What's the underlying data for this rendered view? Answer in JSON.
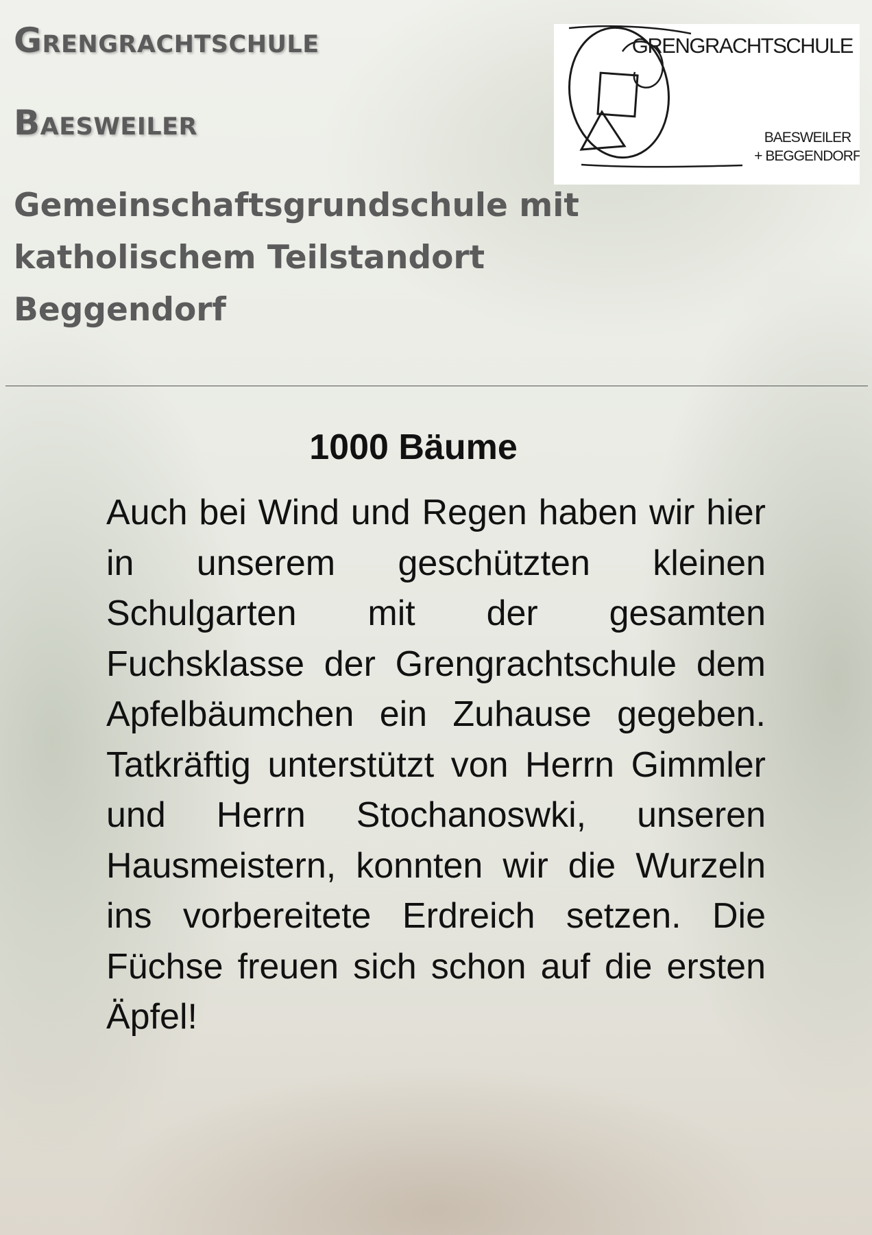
{
  "header": {
    "school_name_line1": "Grengrachtschule",
    "school_name_line2": "Baesweiler",
    "subtitle_line1": "Gemeinschaftsgrundschule mit",
    "subtitle_line2": "katholischem Teilstandort",
    "subtitle_line3": "Beggendorf"
  },
  "logo": {
    "title": "GRENGRACHTSCHULE",
    "location_line1": "BAESWEILER",
    "location_line2": "+ BEGGENDORF"
  },
  "article": {
    "title": "1000 Bäume",
    "body": "Auch bei Wind und Regen haben wir hier in unserem geschützten kleinen Schulgarten mit der gesamten Fuchsklasse der Grengrachtschule dem Apfelbäumchen ein Zuhause gegeben. Tatkräftig unterstützt von Herrn Gimmler und Herrn Stochanoswki, unseren Hausmeistern, konnten wir die Wurzeln ins vorbereitete Erdreich setzen. Die Füchse freuen sich schon auf die ersten Äpfel!"
  },
  "colors": {
    "header_text": "#5b5b5b",
    "body_text": "#111111",
    "divider": "#555555"
  }
}
